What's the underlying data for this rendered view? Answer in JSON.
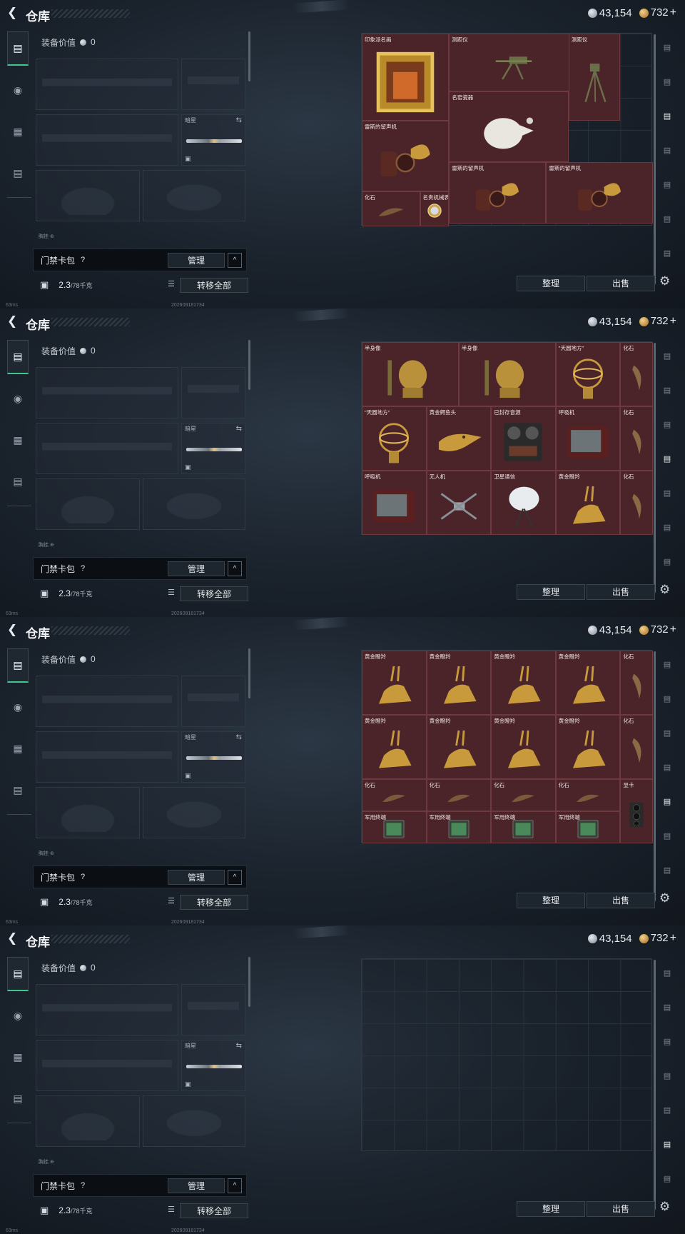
{
  "header": {
    "title": "仓库",
    "silver": "43,154",
    "gold": "732",
    "plus": "+"
  },
  "equip": {
    "value_label": "装备价值",
    "value": "0",
    "knife_label": "暗星",
    "small_label": "胸挂  ⊕"
  },
  "keycard": {
    "label": "门禁卡包",
    "help": "?",
    "manage": "管理",
    "expand": "^"
  },
  "capacity": {
    "value": "2.3",
    "max": "/78千克",
    "transfer": "转移全部"
  },
  "footer": {
    "ping": "63ms",
    "timestamp": "202609181734"
  },
  "actions": {
    "sort": "整理",
    "sell": "出售"
  },
  "colors": {
    "accent_green": "#41c78e",
    "item_bg": "#4a2429",
    "gold_item": "#c99a3c"
  },
  "pages": [
    {
      "items": [
        {
          "name": "印象派名画",
          "kind": "painting"
        },
        {
          "name": "测距仪",
          "kind": "rangefinder"
        },
        {
          "name": "测距仪",
          "kind": "tripod"
        },
        {
          "name": "名窑瓷器",
          "kind": "vase"
        },
        {
          "name": "雷斯的留声机",
          "kind": "phonograph"
        },
        {
          "name": "雷斯的留声机",
          "kind": "phonograph"
        },
        {
          "name": "雷斯的留声机",
          "kind": "phonograph"
        },
        {
          "name": "化石",
          "kind": "fossil"
        },
        {
          "name": "名贵机械表",
          "kind": "watch"
        }
      ]
    },
    {
      "items": [
        {
          "name": "半身像",
          "kind": "bust"
        },
        {
          "name": "半身像",
          "kind": "bust"
        },
        {
          "name": "\"天圆地方\"",
          "kind": "armillary"
        },
        {
          "name": "化石",
          "kind": "claw"
        },
        {
          "name": "\"天圆地方\"",
          "kind": "armillary"
        },
        {
          "name": "黄金鳄鱼头",
          "kind": "croc"
        },
        {
          "name": "已封存音源",
          "kind": "reel"
        },
        {
          "name": "呼吸机",
          "kind": "monitor"
        },
        {
          "name": "化石",
          "kind": "claw"
        },
        {
          "name": "呼吸机",
          "kind": "monitor"
        },
        {
          "name": "无人机",
          "kind": "drone"
        },
        {
          "name": "卫星通信",
          "kind": "dish"
        },
        {
          "name": "黄金瞪羚",
          "kind": "gazelle"
        },
        {
          "name": "化石",
          "kind": "claw"
        }
      ]
    },
    {
      "items": [
        {
          "name": "黄金瞪羚",
          "kind": "gazelle"
        },
        {
          "name": "黄金瞪羚",
          "kind": "gazelle"
        },
        {
          "name": "黄金瞪羚",
          "kind": "gazelle"
        },
        {
          "name": "黄金瞪羚",
          "kind": "gazelle"
        },
        {
          "name": "化石",
          "kind": "claw"
        },
        {
          "name": "黄金瞪羚",
          "kind": "gazelle"
        },
        {
          "name": "黄金瞪羚",
          "kind": "gazelle"
        },
        {
          "name": "黄金瞪羚",
          "kind": "gazelle"
        },
        {
          "name": "黄金瞪羚",
          "kind": "gazelle"
        },
        {
          "name": "化石",
          "kind": "claw"
        },
        {
          "name": "化石",
          "kind": "fossil"
        },
        {
          "name": "化石",
          "kind": "fossil"
        },
        {
          "name": "化石",
          "kind": "fossil"
        },
        {
          "name": "化石",
          "kind": "fossil"
        },
        {
          "name": "显卡",
          "kind": "gpu"
        },
        {
          "name": "军用终端",
          "kind": "terminal"
        },
        {
          "name": "军用终端",
          "kind": "terminal"
        },
        {
          "name": "军用终端",
          "kind": "terminal"
        },
        {
          "name": "军用终端",
          "kind": "terminal"
        }
      ]
    },
    {
      "items": []
    }
  ]
}
